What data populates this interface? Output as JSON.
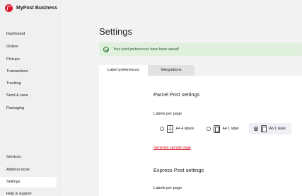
{
  "brand": {
    "name": "MyPost Business",
    "color": "#dc1928"
  },
  "sidebar": {
    "items": [
      {
        "label": "Dashboard",
        "active": false
      },
      {
        "label": "Orders",
        "active": false
      },
      {
        "label": "Pickups",
        "active": false
      },
      {
        "label": "Transactions",
        "active": false
      },
      {
        "label": "Tracking",
        "active": false
      },
      {
        "label": "Send & save",
        "active": false
      },
      {
        "label": "Packaging",
        "active": false
      }
    ],
    "bottom_items": [
      {
        "label": "Services",
        "active": false
      },
      {
        "label": "Address book",
        "active": false
      },
      {
        "label": "Settings",
        "active": true
      },
      {
        "label": "Help & support",
        "active": false
      }
    ]
  },
  "page": {
    "title": "Settings"
  },
  "alert": {
    "text": "Your print preferences have been saved!",
    "icon": "check-circle-icon",
    "color": "#dff0dc"
  },
  "tabs": [
    {
      "label": "Label preferences",
      "active": true
    },
    {
      "label": "Integrations",
      "active": false
    }
  ],
  "parcel_post": {
    "title": "Parcel Post settings",
    "labels_per_page_label": "Labels per page",
    "options": [
      {
        "label": "A4 4 labels",
        "icon": "a4-four-labels-icon",
        "selected": false
      },
      {
        "label": "A4 1 label",
        "icon": "a4-one-label-icon",
        "selected": false
      },
      {
        "label": "A6 1 label",
        "icon": "a6-one-label-icon",
        "selected": true
      }
    ],
    "sample_link": "Generate sample page"
  },
  "express_post": {
    "title": "Express Post settings",
    "labels_per_page_label": "Labels per page"
  }
}
